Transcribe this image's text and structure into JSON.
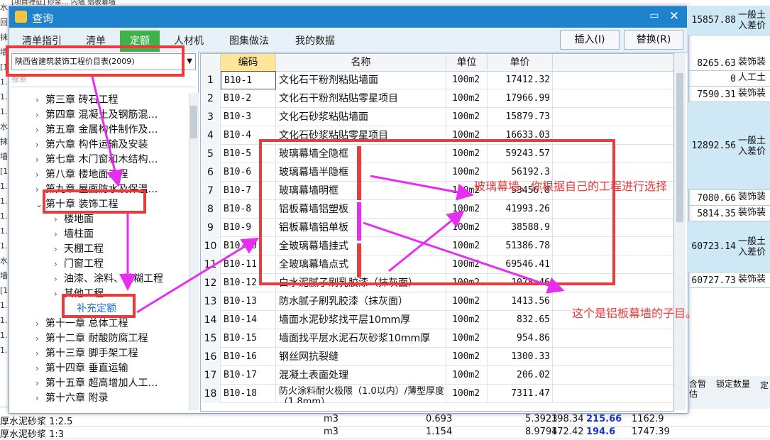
{
  "background": {
    "top_text": "[项目特征]  砂浆...  内墙  铝板幕墙",
    "left_strip": [
      "水",
      "回",
      "抹",
      "墙",
      "[1",
      "1.",
      "1.",
      "1.",
      "水",
      "抹",
      "墙",
      "[1",
      "1.",
      "1.",
      "1.",
      "1.",
      "1.",
      "水",
      "墙",
      "[1",
      "1.",
      "1.",
      "1.",
      "1."
    ],
    "right_rows": [
      {
        "value": "15857.88",
        "text": "一般土入差价",
        "hl": true
      },
      {
        "value": "8265.63",
        "text": "装饰装",
        "hl": false
      },
      {
        "value": "0",
        "text": "人工土",
        "hl": false
      },
      {
        "value": "7590.31",
        "text": "装饰装",
        "hl": false
      },
      {
        "value": "12892.56",
        "text": "一般土入差价",
        "hl": true
      },
      {
        "value": "7080.66",
        "text": "装饰装",
        "hl": false
      },
      {
        "value": "5814.35",
        "text": "装饰装",
        "hl": false
      },
      {
        "value": "60723.14",
        "text": "一般土入差价",
        "hl": true
      },
      {
        "value": "60727.73",
        "text": "装饰装",
        "hl": false
      }
    ],
    "right_header": {
      "col1": "含暂估",
      "col2": "锁定数量",
      "col3": "定"
    },
    "bottom_rows": [
      {
        "name": "厚水泥砂浆 1:2.5",
        "unit": "m3",
        "qty": "0.693",
        "v1": "5.3923",
        "v2": "198.34",
        "v3": "215.66",
        "v4": "1162.9"
      },
      {
        "name": "厚水泥砂浆 1:3",
        "unit": "m3",
        "qty": "1.154",
        "v1": "8.9794",
        "v2": "172.42",
        "v3": "194.6",
        "v4": "1747.39"
      }
    ]
  },
  "dialog": {
    "title": "查询",
    "max_label": "▭",
    "close_label": "✕",
    "tabs": [
      "清单指引",
      "清单",
      "定额",
      "人材机",
      "图集做法",
      "我的数据"
    ],
    "active_tab": "定额",
    "insert_label": "插入(I)",
    "replace_label": "替换(R)",
    "library": "陕西省建筑装饰工程价目表(2009)",
    "search_placeholder": "搜索",
    "tree": [
      {
        "label": "第三章  砖石工程",
        "expanded": false,
        "level": 0
      },
      {
        "label": "第四章  混凝土及钢筋混…",
        "expanded": false,
        "level": 0
      },
      {
        "label": "第五章  金属构件制作及…",
        "expanded": false,
        "level": 0
      },
      {
        "label": "第六章  构件运输及安装",
        "expanded": false,
        "level": 0
      },
      {
        "label": "第七章  木门窗和木结构…",
        "expanded": false,
        "level": 0
      },
      {
        "label": "第八章  楼地面工程",
        "expanded": false,
        "level": 0
      },
      {
        "label": "第九章  屋面防水及保温…",
        "expanded": false,
        "level": 0
      },
      {
        "label": "第十章  装饰工程",
        "expanded": true,
        "level": 0
      },
      {
        "label": "楼地面",
        "expanded": false,
        "level": 1
      },
      {
        "label": "墙柱面",
        "expanded": false,
        "level": 1
      },
      {
        "label": "天棚工程",
        "expanded": false,
        "level": 1
      },
      {
        "label": "门窗工程",
        "expanded": false,
        "level": 1
      },
      {
        "label": "油漆、涂料、裱糊工程",
        "expanded": false,
        "level": 1
      },
      {
        "label": "其他工程",
        "expanded": false,
        "level": 1
      },
      {
        "label": "补充定额",
        "expanded": null,
        "level": 2
      },
      {
        "label": "第十一章  总体工程",
        "expanded": false,
        "level": 0
      },
      {
        "label": "第十二章  耐酸防腐工程",
        "expanded": false,
        "level": 0
      },
      {
        "label": "第十三章  脚手架工程",
        "expanded": false,
        "level": 0
      },
      {
        "label": "第十四章  垂直运输",
        "expanded": false,
        "level": 0
      },
      {
        "label": "第十五章  超高增加人工…",
        "expanded": false,
        "level": 0
      },
      {
        "label": "第十六章  附录",
        "expanded": false,
        "level": 0
      }
    ],
    "grid": {
      "headers": {
        "code": "编码",
        "name": "名称",
        "unit": "单位",
        "price": "单价"
      },
      "rows": [
        {
          "idx": "1",
          "code": "B10-1",
          "name": "文化石干粉剂粘贴墙面",
          "unit": "100m2",
          "price": "17412.32"
        },
        {
          "idx": "2",
          "code": "B10-2",
          "name": "文化石干粉剂粘贴零星项目",
          "unit": "100m2",
          "price": "17966.99"
        },
        {
          "idx": "3",
          "code": "B10-3",
          "name": "文化石砂浆粘贴墙面",
          "unit": "100m2",
          "price": "15879.73"
        },
        {
          "idx": "4",
          "code": "B10-4",
          "name": "文化石砂浆粘贴零星项目",
          "unit": "100m2",
          "price": "16633.03"
        },
        {
          "idx": "5",
          "code": "B10-5",
          "name": "玻璃幕墙全隐框",
          "unit": "100m2",
          "price": "59243.57"
        },
        {
          "idx": "6",
          "code": "B10-6",
          "name": "玻璃幕墙半隐框",
          "unit": "100m2",
          "price": "56192.3"
        },
        {
          "idx": "7",
          "code": "B10-7",
          "name": "玻璃幕墙明框",
          "unit": "100m2",
          "price": "53456.8"
        },
        {
          "idx": "8",
          "code": "B10-8",
          "name": "铝板幕墙铝塑板",
          "unit": "100m2",
          "price": "41993.26"
        },
        {
          "idx": "9",
          "code": "B10-9",
          "name": "铝板幕墙铝单板",
          "unit": "100m2",
          "price": "38588.9"
        },
        {
          "idx": "10",
          "code": "B10-10",
          "name": "全玻璃幕墙挂式",
          "unit": "100m2",
          "price": "51386.78"
        },
        {
          "idx": "11",
          "code": "B10-11",
          "name": "全玻璃幕墙点式",
          "unit": "100m2",
          "price": "69546.41"
        },
        {
          "idx": "12",
          "code": "B10-12",
          "name": "白水泥腻子刷乳胶漆（抹灰面）",
          "unit": "100m2",
          "price": "1078.46"
        },
        {
          "idx": "13",
          "code": "B10-13",
          "name": "防水腻子刷乳胶漆（抹灰面）",
          "unit": "100m2",
          "price": "1413.56"
        },
        {
          "idx": "14",
          "code": "B10-14",
          "name": "墙面水泥砂浆找平层10mm厚",
          "unit": "100m2",
          "price": "832.65"
        },
        {
          "idx": "15",
          "code": "B10-15",
          "name": "墙面找平层水泥石灰砂浆10mm厚",
          "unit": "100m2",
          "price": "954.86"
        },
        {
          "idx": "16",
          "code": "B10-16",
          "name": "钢丝网抗裂缝",
          "unit": "100m2",
          "price": "1300.33"
        },
        {
          "idx": "17",
          "code": "B10-17",
          "name": "混凝土表面处理",
          "unit": "100m2",
          "price": "206.02"
        },
        {
          "idx": "18",
          "code": "B10-18",
          "name": "防火涂料耐火极限（1.0以内）/薄型厚度（1.8mm）",
          "unit": "100m2",
          "price": "7311.47"
        }
      ]
    }
  },
  "annotations": {
    "note_glass": "玻璃幕墙，你根据自己的工程进行选择",
    "note_aluminum": "这个是铝板幕墙的子目。",
    "red": "#ec3b3b",
    "magenta": "#e62ef0"
  },
  "colors": {
    "titlebar": "#1e82cc",
    "active_tab": "#40b24a",
    "code_header": "#fde69a"
  }
}
